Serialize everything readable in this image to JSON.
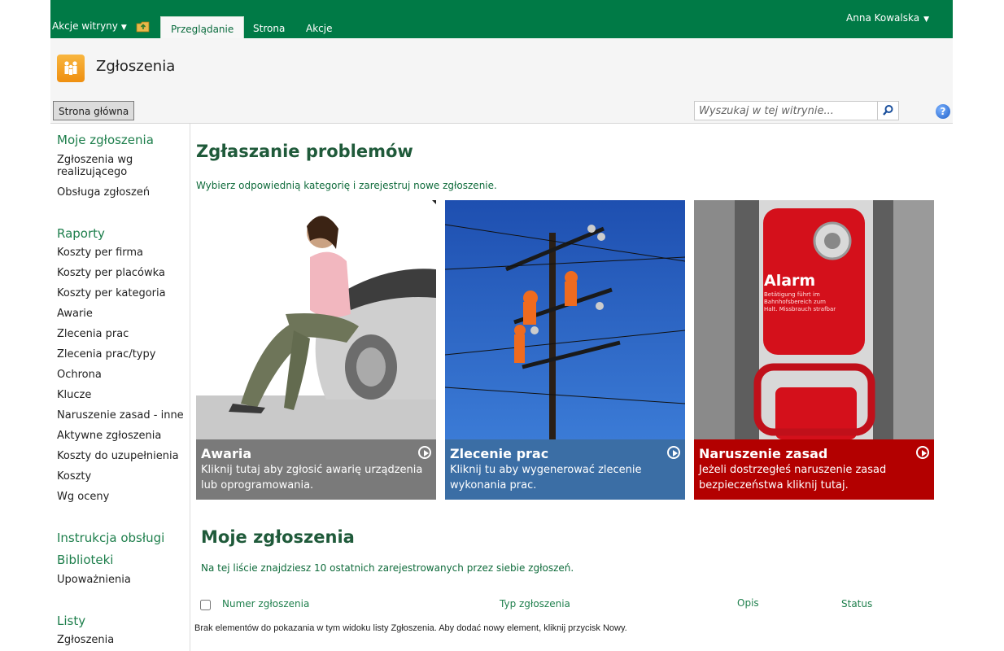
{
  "ribbon": {
    "site_actions": "Akcje witryny",
    "tabs": [
      {
        "label": "Przeglądanie",
        "active": true
      },
      {
        "label": "Strona",
        "active": false
      },
      {
        "label": "Akcje",
        "active": false
      }
    ],
    "user": "Anna Kowalska"
  },
  "site": {
    "title": "Zgłoszenia",
    "logo_icon": "people-icon"
  },
  "topnav": {
    "home": "Strona główna",
    "search_placeholder": "Wyszukaj w tej witrynie...",
    "search_icon": "magnifier-icon",
    "help_icon": "help-icon"
  },
  "left_nav": {
    "my_header": "Moje zgłoszenia",
    "my_items": [
      "Zgłoszenia wg realizującego",
      "Obsługa zgłoszeń"
    ],
    "reports_header": "Raporty",
    "reports": [
      "Koszty per firma",
      "Koszty per placówka",
      "Koszty per kategoria",
      "Awarie",
      "Zlecenia prac",
      "Zlecenia prac/typy",
      "Ochrona",
      "Klucze",
      "Naruszenie zasad - inne",
      "Aktywne zgłoszenia",
      "Koszty do uzupełnienia",
      "Koszty",
      "Wg oceny"
    ],
    "manual": "Instrukcja obsługi",
    "libraries_header": "Biblioteki",
    "libraries": [
      "Upoważnienia"
    ],
    "lists_header": "Listy",
    "lists": [
      "Zgłoszenia"
    ]
  },
  "main": {
    "title": "Zgłaszanie problemów",
    "description": "Wybierz odpowiednią kategorię i zarejestruj nowe zgłoszenie.",
    "tiles": [
      {
        "title": "Awaria",
        "description": "Kliknij tutaj aby zgłosić awarię urządzenia lub oprogramowania.",
        "color": "#7a7a7a"
      },
      {
        "title": "Zlecenie prac",
        "description": "Kliknij tu aby wygenerować zlecenie wykonania prac.",
        "color": "#3b6ea5"
      },
      {
        "title": "Naruszenie zasad",
        "description": "Jeżeli dostrzegłeś naruszenie zasad bezpieczeństwa kliknij tutaj.",
        "color": "#b30000"
      }
    ],
    "alarm_sign": {
      "word": "Alarm",
      "small": "Betätigung führt im Bahnhofsbereich zum Halt. Missbrauch strafbar"
    },
    "my_title": "Moje zgłoszenia",
    "my_description": "Na tej liście znajdziesz 10 ostatnich zarejestrowanych przez siebie zgłoszeń.",
    "columns": [
      "Numer zgłoszenia",
      "Typ zgłoszenia",
      "Opis",
      "Status"
    ],
    "empty_message": "Brak elementów do pokazania w tym widoku listy Zgłoszenia. Aby dodać nowy element, kliknij przycisk Nowy."
  },
  "colors": {
    "ribbon": "#007a46",
    "accent_green": "#1e7f4c"
  }
}
